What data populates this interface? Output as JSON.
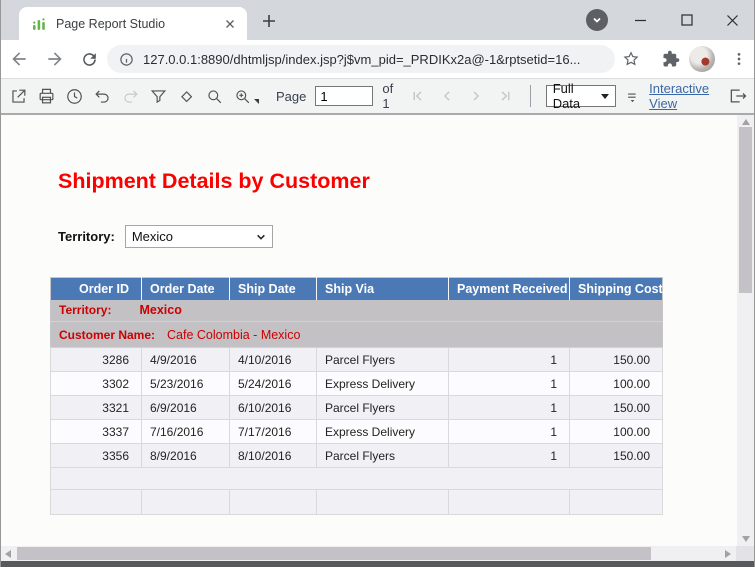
{
  "browser": {
    "tab_title": "Page Report Studio",
    "url": "127.0.0.1:8890/dhtmljsp/index.jsp?j$vm_pid=_PRDIKx2a@-1&rptsetid=16...",
    "icons": [
      "app-favicon",
      "tab-close",
      "new-tab",
      "media-controls",
      "window-minimize",
      "window-maximize",
      "window-close",
      "back",
      "forward",
      "reload",
      "page-info",
      "bookmark-star",
      "extensions-puzzle",
      "profile-avatar",
      "menu-dots"
    ]
  },
  "report_toolbar": {
    "page_label": "Page",
    "page_value": "1",
    "page_total_label": "of 1",
    "data_mode_value": "Full Data",
    "interactive_view_label": "Interactive View",
    "icons": [
      "export",
      "print",
      "schedule-clock",
      "undo",
      "redo",
      "filter-funnel",
      "select-diamond",
      "search",
      "zoom-in",
      "nav-first",
      "nav-prev",
      "nav-next",
      "nav-last",
      "toolbar-options",
      "exit"
    ]
  },
  "report": {
    "title": "Shipment Details by Customer",
    "territory_label": "Territory:",
    "territory_value": "Mexico"
  },
  "table": {
    "columns": [
      "Order ID",
      "Order Date",
      "Ship Date",
      "Ship Via",
      "Payment Received",
      "Shipping Cost"
    ],
    "group": {
      "territory_label": "Territory:",
      "territory_value": "Mexico",
      "customer_label": "Customer Name:",
      "customer_value": "Cafe Colombia - Mexico"
    },
    "rows": [
      [
        "3286",
        "4/9/2016",
        "4/10/2016",
        "Parcel Flyers",
        "1",
        "150.00"
      ],
      [
        "3302",
        "5/23/2016",
        "5/24/2016",
        "Express Delivery",
        "1",
        "100.00"
      ],
      [
        "3321",
        "6/9/2016",
        "6/10/2016",
        "Parcel Flyers",
        "1",
        "150.00"
      ],
      [
        "3337",
        "7/16/2016",
        "7/17/2016",
        "Express Delivery",
        "1",
        "100.00"
      ],
      [
        "3356",
        "8/9/2016",
        "8/10/2016",
        "Parcel Flyers",
        "1",
        "150.00"
      ]
    ]
  },
  "colors": {
    "table_header_bg": "#4A79B6",
    "group_row_bg": "#C3C1C4",
    "group_text_red": "#CC0000",
    "title_red": "#FA0000",
    "link_blue": "#3A67A8",
    "favicon_green": "#64B54A"
  }
}
